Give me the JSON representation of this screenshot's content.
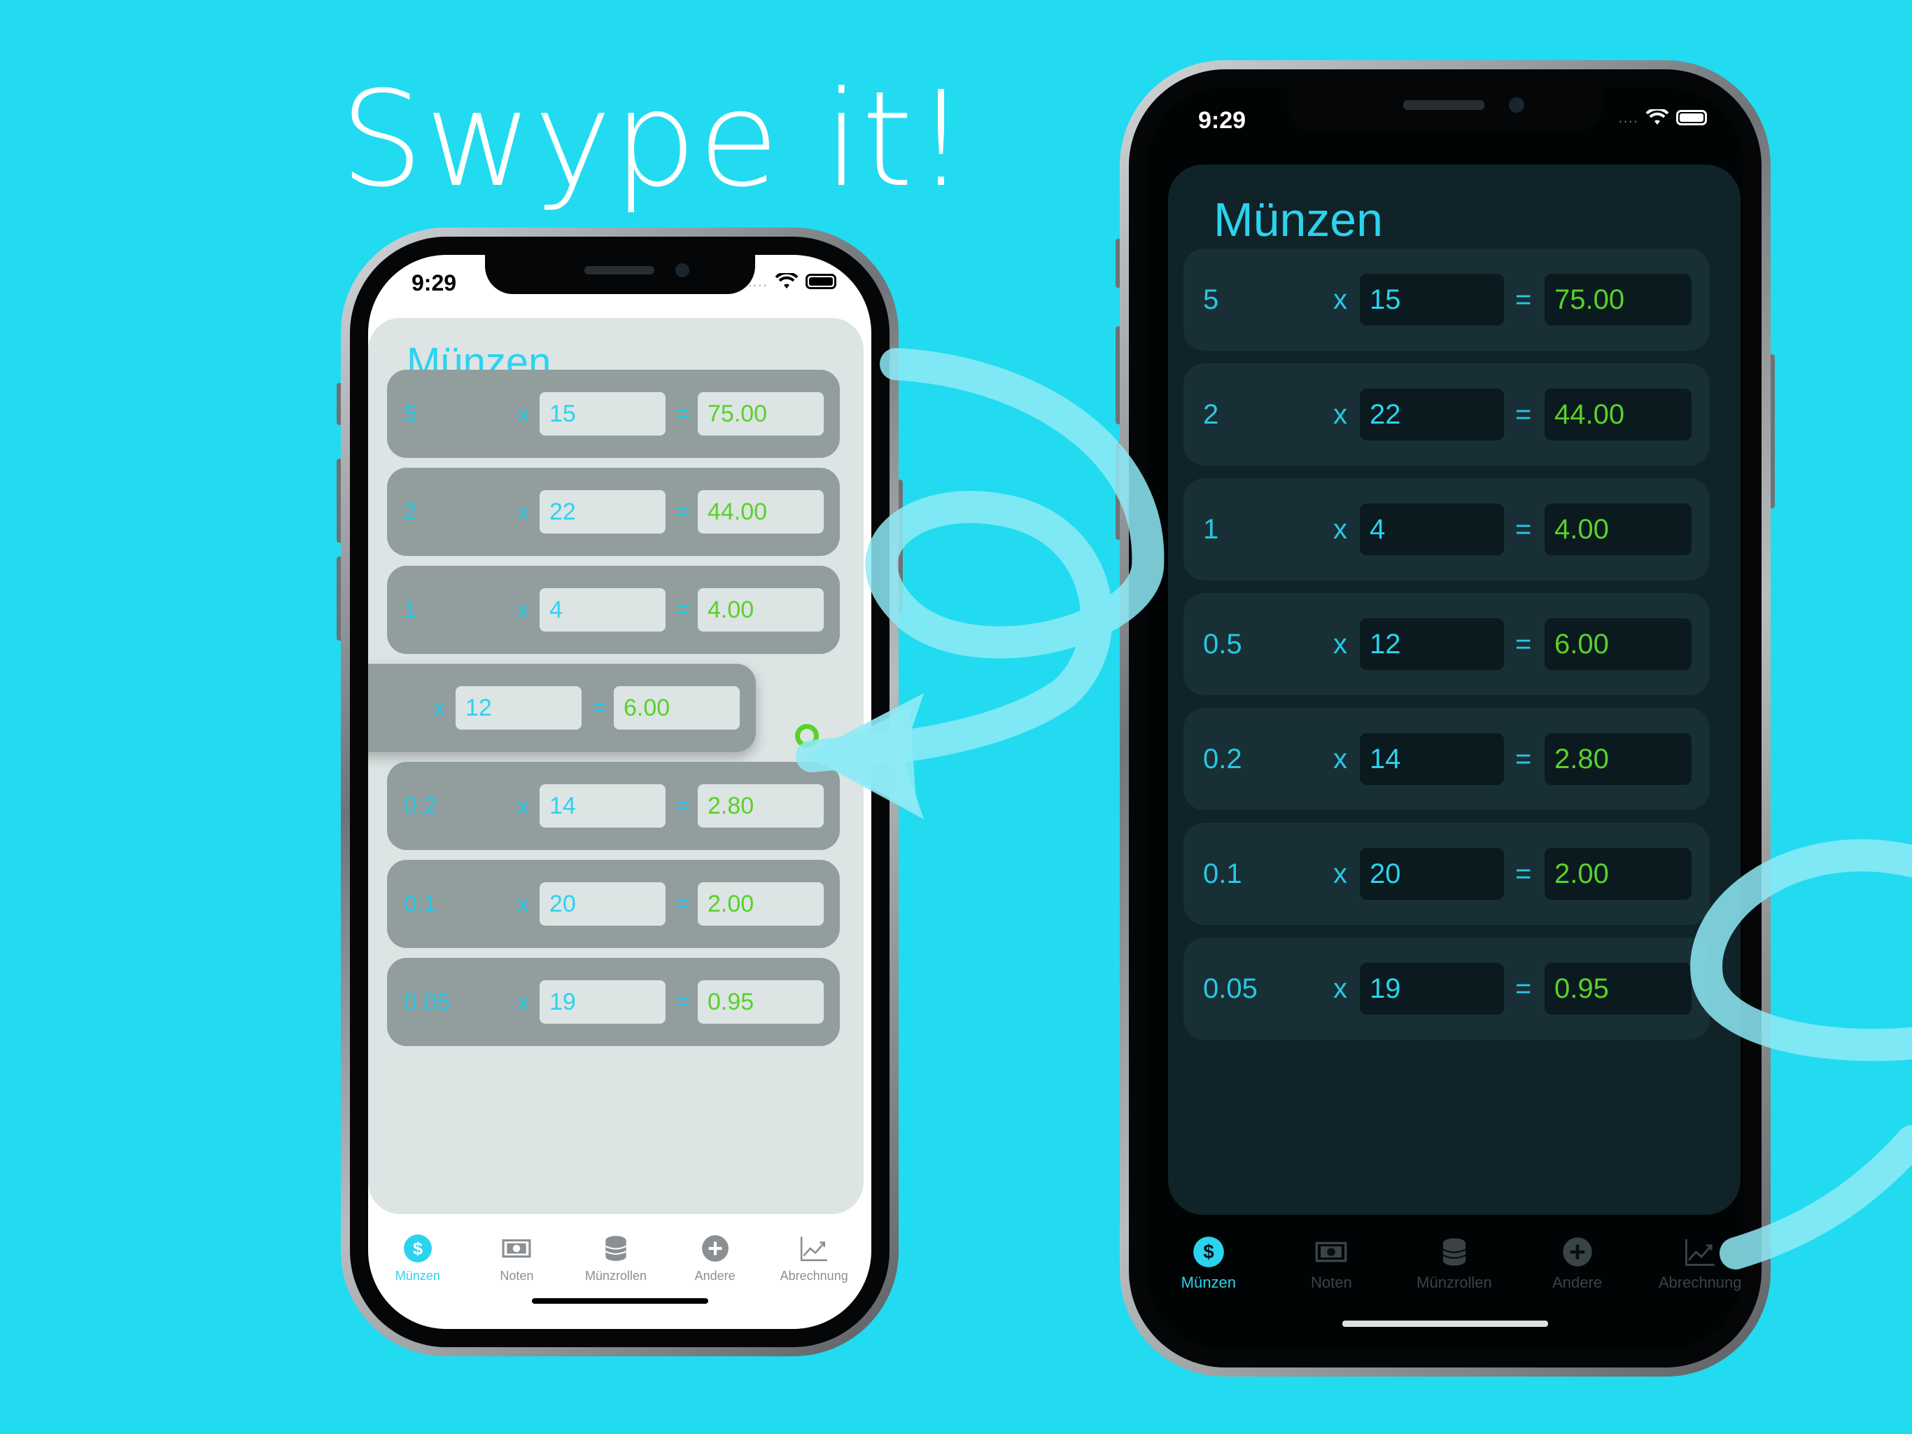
{
  "headline": "Swype it!",
  "status": {
    "time": "9:29",
    "signal_dots": "...."
  },
  "card": {
    "title": "Münzen"
  },
  "rows": [
    {
      "denomination": "5",
      "times": "x",
      "quantity": "15",
      "equals": "=",
      "total": "75.00"
    },
    {
      "denomination": "2",
      "times": "x",
      "quantity": "22",
      "equals": "=",
      "total": "44.00"
    },
    {
      "denomination": "1",
      "times": "x",
      "quantity": "4",
      "equals": "=",
      "total": "4.00"
    },
    {
      "denomination": "0.5",
      "times": "x",
      "quantity": "12",
      "equals": "=",
      "total": "6.00"
    },
    {
      "denomination": "0.2",
      "times": "x",
      "quantity": "14",
      "equals": "=",
      "total": "2.80"
    },
    {
      "denomination": "0.1",
      "times": "x",
      "quantity": "20",
      "equals": "=",
      "total": "2.00"
    },
    {
      "denomination": "0.05",
      "times": "x",
      "quantity": "19",
      "equals": "=",
      "total": "0.95"
    }
  ],
  "tabs": [
    {
      "label": "Münzen",
      "icon": "dollar-coin-icon",
      "selected": true
    },
    {
      "label": "Noten",
      "icon": "banknote-icon",
      "selected": false
    },
    {
      "label": "Münzrollen",
      "icon": "coin-stack-icon",
      "selected": false
    },
    {
      "label": "Andere",
      "icon": "plus-circle-icon",
      "selected": false
    },
    {
      "label": "Abrechnung",
      "icon": "chart-icon",
      "selected": false
    }
  ],
  "colors": {
    "background": "#22dbf0",
    "accent": "#2bd3ef",
    "total_green": "#59d12a",
    "ribbon": "#8eeaf6"
  }
}
